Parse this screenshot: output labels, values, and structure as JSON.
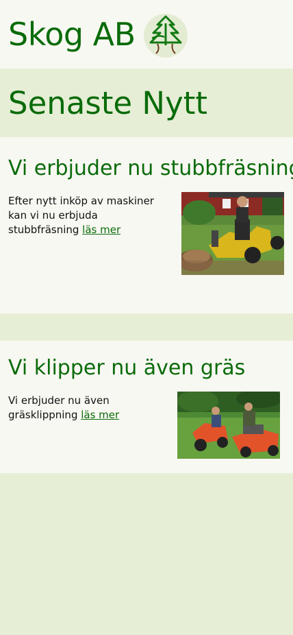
{
  "header": {
    "site_title": "Skog AB",
    "logo_icon": "tree-logo-icon"
  },
  "page": {
    "title": "Senaste Nytt"
  },
  "articles": [
    {
      "title": "Vi erbjuder nu stubbfräsning",
      "text": "Efter nytt inköp av maskiner kan vi nu erbjuda stubbfräsning",
      "link_label": "läs mer",
      "image_icon": "stump-grinder-photo"
    },
    {
      "title": "Vi klipper nu även gräs",
      "text": "Vi erbjuder nu även gräsklippning",
      "link_label": "läs mer",
      "image_icon": "lawn-mower-photo"
    }
  ],
  "colors": {
    "brand_green": "#0a6b0a",
    "background": "#e6eed6",
    "card": "#f8f8f2"
  }
}
